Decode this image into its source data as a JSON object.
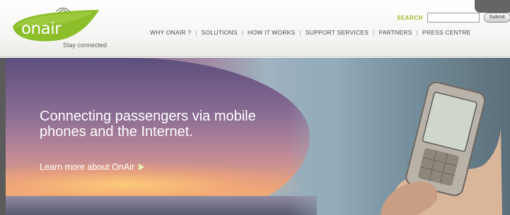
{
  "logo": {
    "text": "onair",
    "tagline": "Stay connected",
    "color": "#8cbe2a"
  },
  "search": {
    "label": "SEARCH",
    "value": "",
    "placeholder": "",
    "button_label": "Submit"
  },
  "nav": {
    "items": [
      {
        "label": "WHY ONAIR ?"
      },
      {
        "label": "SOLUTIONS"
      },
      {
        "label": "HOW IT WORKS"
      },
      {
        "label": "SUPPORT SERVICES"
      },
      {
        "label": "PARTNERS"
      },
      {
        "label": "PRESS CENTRE"
      }
    ],
    "separator": "|"
  },
  "hero": {
    "headline": "Connecting passengers via mobile phones and the Internet.",
    "link_label": "Learn more about OnAir",
    "link_icon": "arrow-right-icon"
  },
  "colors": {
    "accent": "#9dba27",
    "nav_text": "#4a4a4a"
  }
}
